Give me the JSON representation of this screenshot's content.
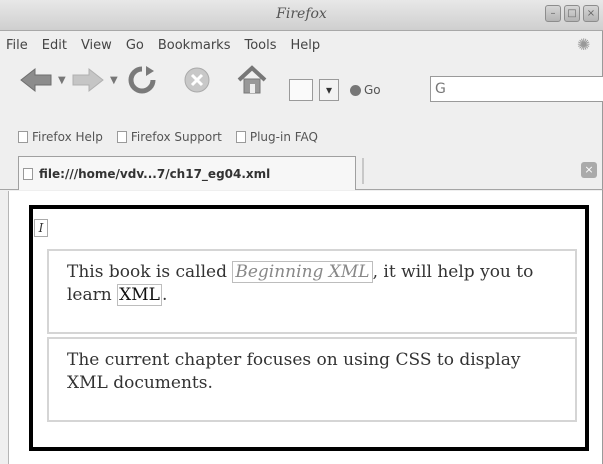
{
  "window": {
    "title": "Firefox"
  },
  "menubar": {
    "items": [
      {
        "label": "File"
      },
      {
        "label": "Edit"
      },
      {
        "label": "View"
      },
      {
        "label": "Go"
      },
      {
        "label": "Bookmarks"
      },
      {
        "label": "Tools"
      },
      {
        "label": "Help"
      }
    ]
  },
  "navbar": {
    "go_label": "Go",
    "search_value": "G"
  },
  "bookmarks": {
    "items": [
      {
        "label": "Firefox Help"
      },
      {
        "label": "Firefox Support"
      },
      {
        "label": "Plug-in FAQ"
      }
    ]
  },
  "tabs": [
    {
      "label": "file:///home/vdv...7/ch17_eg04.xml"
    }
  ],
  "document": {
    "marker": "I",
    "para1": {
      "before": "This book is called ",
      "title": "Beginning XML",
      "middle": ", it will help you to learn ",
      "term": "XML",
      "after": "."
    },
    "para2": {
      "text": "The current chapter focuses on using CSS to display XML documents."
    }
  },
  "colors": {
    "chrome": "#efefef",
    "frame_border": "#000000",
    "text": "#333333"
  }
}
